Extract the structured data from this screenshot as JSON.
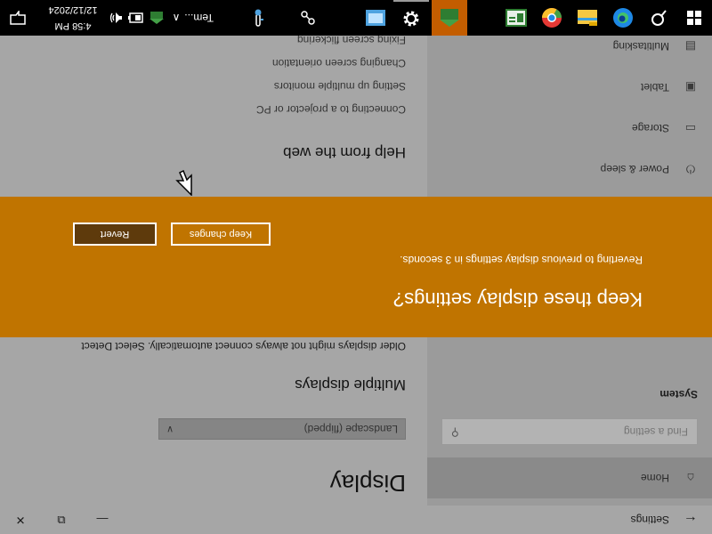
{
  "window": {
    "title": "Settings",
    "back_glyph": "←",
    "minimize_glyph": "—",
    "maximize_glyph": "⧉",
    "close_glyph": "✕"
  },
  "sidebar": {
    "home_label": "Home",
    "search_placeholder": "Find a setting",
    "section_label": "System",
    "items": [
      {
        "label": "Power & sleep",
        "icon": "power-icon",
        "glyph": "⏻"
      },
      {
        "label": "Storage",
        "icon": "storage-icon",
        "glyph": "▭"
      },
      {
        "label": "Tablet",
        "icon": "tablet-icon",
        "glyph": "▣"
      },
      {
        "label": "Multitasking",
        "icon": "multitasking-icon",
        "glyph": "▤"
      }
    ]
  },
  "main": {
    "page_title": "Display",
    "orientation_value": "Landscape (flipped)",
    "multiple_displays_title": "Multiple displays",
    "multiple_displays_desc": "Older displays might not always connect automatically. Select Detect",
    "help_title": "Help from the web",
    "help_links": [
      "Connecting to a projector or PC",
      "Setting up multiple monitors",
      "Changing screen orientation",
      "Fixing screen flickering"
    ]
  },
  "dialog": {
    "title": "Keep these display settings?",
    "message": "Reverting to previous display settings in  3 seconds.",
    "keep_label": "Keep changes",
    "revert_label": "Revert",
    "background_color": "#c07400"
  },
  "taskbar": {
    "running_app_label": "Tem...",
    "clock_time": "4:58 PM",
    "clock_date": "12/12/2024",
    "tray_chevron": "∧"
  }
}
